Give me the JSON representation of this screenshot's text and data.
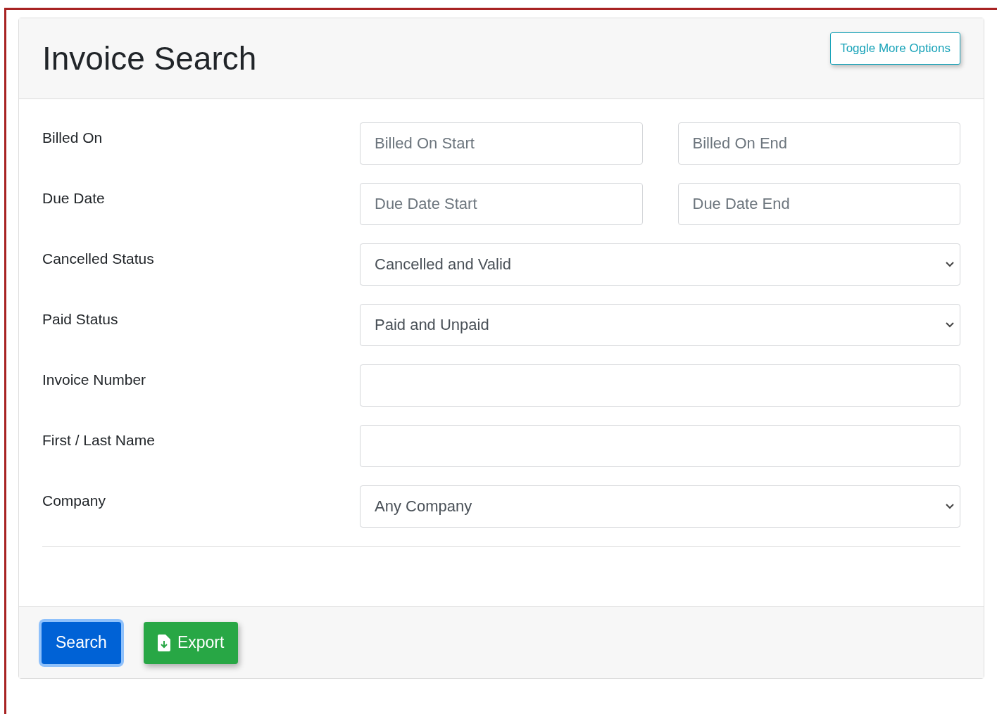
{
  "header": {
    "title": "Invoice Search",
    "toggle_button": "Toggle More Options"
  },
  "rows": [
    {
      "label": "Billed On",
      "kind": "range",
      "start_placeholder": "Billed On Start",
      "end_placeholder": "Billed On End"
    },
    {
      "label": "Due Date",
      "kind": "range",
      "start_placeholder": "Due Date Start",
      "end_placeholder": "Due Date End"
    },
    {
      "label": "Cancelled Status",
      "kind": "select",
      "value": "Cancelled and Valid"
    },
    {
      "label": "Paid Status",
      "kind": "select",
      "value": "Paid and Unpaid"
    },
    {
      "label": "Invoice Number",
      "kind": "text"
    },
    {
      "label": "First / Last Name",
      "kind": "text"
    },
    {
      "label": "Company",
      "kind": "select",
      "value": "Any Company"
    }
  ],
  "footer_buttons": [
    {
      "label": "Search",
      "kind": "primary",
      "focused": true
    },
    {
      "label": "Export",
      "kind": "export",
      "focused": false
    }
  ]
}
